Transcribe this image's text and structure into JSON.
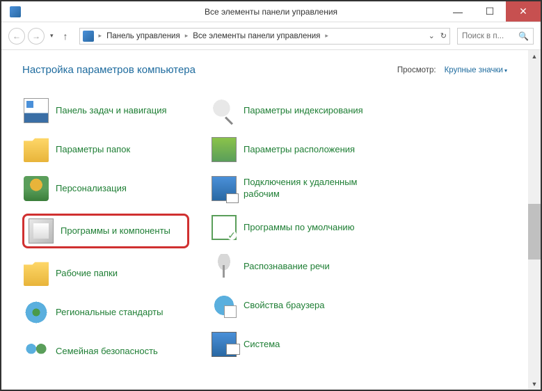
{
  "window": {
    "title": "Все элементы панели управления"
  },
  "breadcrumb": {
    "root": "Панель управления",
    "current": "Все элементы панели управления"
  },
  "search": {
    "placeholder": "Поиск в п..."
  },
  "page": {
    "heading": "Настройка параметров компьютера"
  },
  "view": {
    "label": "Просмотр:",
    "value": "Крупные значки"
  },
  "col1": [
    {
      "label": "Панель задач и навигация"
    },
    {
      "label": "Параметры папок"
    },
    {
      "label": "Персонализация"
    },
    {
      "label": "Программы и компоненты"
    },
    {
      "label": "Рабочие папки"
    },
    {
      "label": "Региональные стандарты"
    },
    {
      "label": "Семейная безопасность"
    }
  ],
  "col2": [
    {
      "label": "Параметры индексирования"
    },
    {
      "label": "Параметры расположения"
    },
    {
      "label": "Подключения к удаленным рабочим"
    },
    {
      "label": "Программы по умолчанию"
    },
    {
      "label": "Распознавание речи"
    },
    {
      "label": "Свойства браузера"
    },
    {
      "label": "Система"
    }
  ]
}
